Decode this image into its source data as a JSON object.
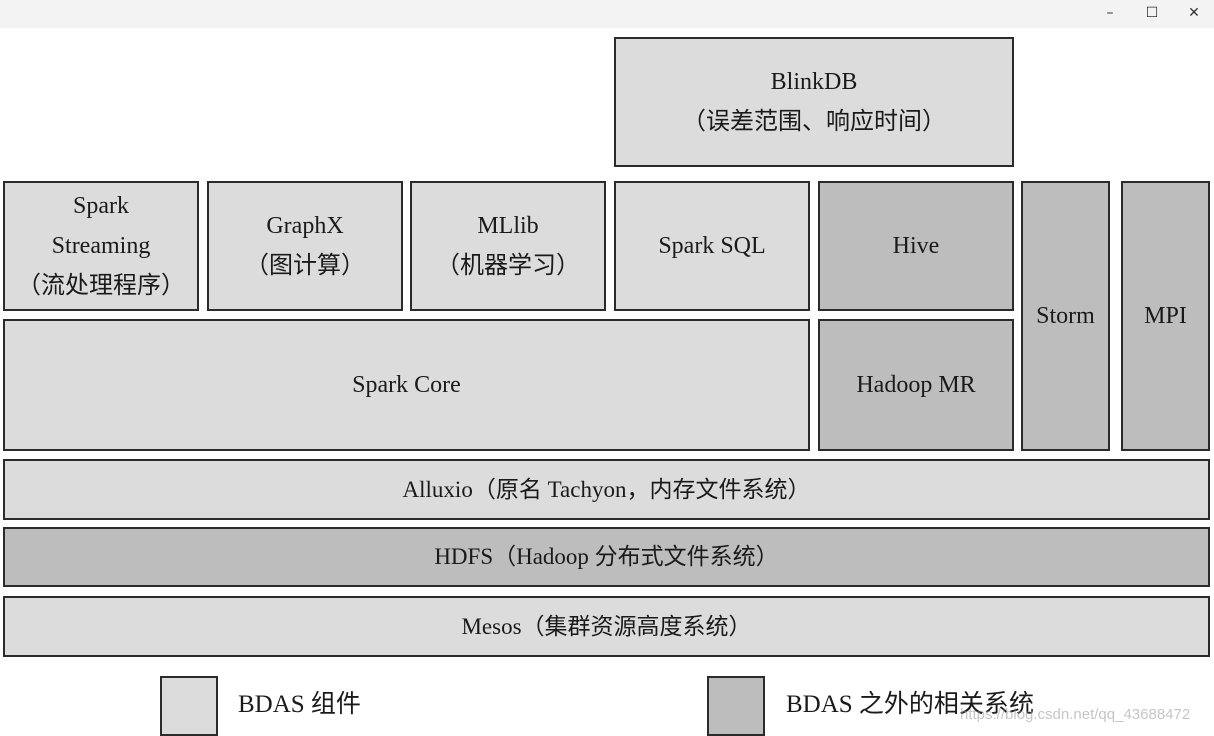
{
  "window": {
    "controls": {
      "minimize": "–",
      "maximize": "☐",
      "close": "✕"
    }
  },
  "diagram": {
    "colors": {
      "bdas_component": "#dcdcdc",
      "related_system": "#bdbdbd",
      "border": "#2b2b2b"
    },
    "blinkdb": {
      "title": "BlinkDB",
      "subtitle": "（误差范围、响应时间）",
      "category": "bdas_component"
    },
    "spark_streaming": {
      "line1": "Spark",
      "line2": "Streaming",
      "line3": "（流处理程序）",
      "category": "bdas_component"
    },
    "graphx": {
      "title": "GraphX",
      "subtitle": "（图计算）",
      "category": "bdas_component"
    },
    "mllib": {
      "title": "MLlib",
      "subtitle": "（机器学习）",
      "category": "bdas_component"
    },
    "spark_sql": {
      "title": "Spark SQL",
      "category": "bdas_component"
    },
    "hive": {
      "title": "Hive",
      "category": "related_system"
    },
    "storm": {
      "title": "Storm",
      "category": "related_system"
    },
    "mpi": {
      "title": "MPI",
      "category": "related_system"
    },
    "spark_core": {
      "title": "Spark Core",
      "category": "bdas_component"
    },
    "hadoop_mr": {
      "title": "Hadoop MR",
      "category": "related_system"
    },
    "alluxio": {
      "title": "Alluxio（原名 Tachyon，内存文件系统）",
      "category": "bdas_component"
    },
    "hdfs": {
      "title": "HDFS（Hadoop 分布式文件系统）",
      "category": "related_system"
    },
    "mesos": {
      "title": "Mesos（集群资源高度系统）",
      "category": "bdas_component"
    }
  },
  "legend": {
    "items": [
      {
        "label": "BDAS 组件",
        "color": "#dcdcdc"
      },
      {
        "label": "BDAS 之外的相关系统",
        "color": "#bdbdbd"
      }
    ]
  },
  "watermark": "https://blog.csdn.net/qq_43688472"
}
